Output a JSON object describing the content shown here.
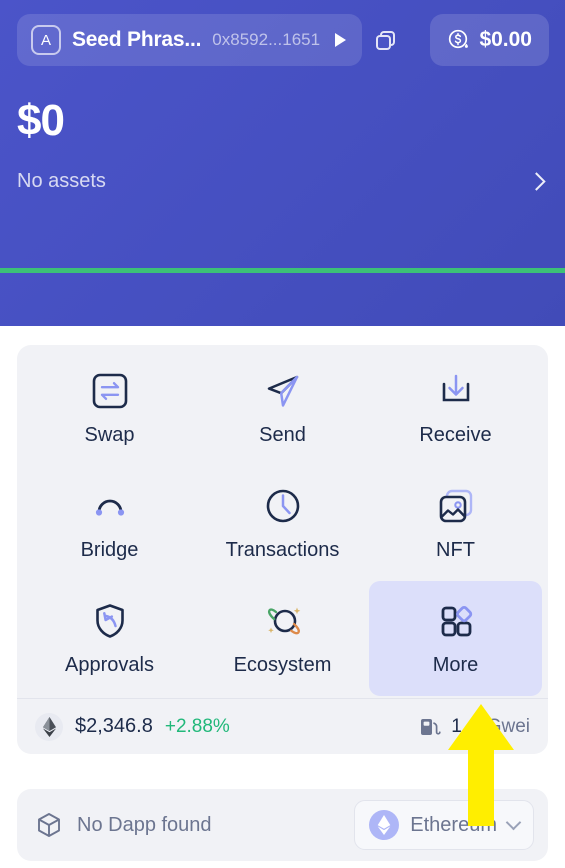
{
  "header": {
    "account_name": "Seed Phras...",
    "account_address": "0x8592...1651",
    "avatar_letter": "A",
    "caret_icon": "caret-right-icon",
    "copy_icon": "copy-icon",
    "fiat_icon": "dollar-drop-icon",
    "fiat_amount": "$0.00"
  },
  "balance": {
    "total": "$0",
    "assets_label": "No assets",
    "chevron_icon": "chevron-right-icon"
  },
  "actions": [
    {
      "label": "Swap",
      "icon": "swap-icon",
      "active": false
    },
    {
      "label": "Send",
      "icon": "send-plane-icon",
      "active": false
    },
    {
      "label": "Receive",
      "icon": "receive-icon",
      "active": false
    },
    {
      "label": "Bridge",
      "icon": "bridge-icon",
      "active": false
    },
    {
      "label": "Transactions",
      "icon": "clock-icon",
      "active": false
    },
    {
      "label": "NFT",
      "icon": "image-stack-icon",
      "active": false
    },
    {
      "label": "Approvals",
      "icon": "shield-arrow-icon",
      "active": false
    },
    {
      "label": "Ecosystem",
      "icon": "planet-icon",
      "active": false
    },
    {
      "label": "More",
      "icon": "grid-diamond-icon",
      "active": true
    }
  ],
  "pricebar": {
    "token_icon": "ethereum-icon",
    "price": "$2,346.8",
    "change": "+2.88%",
    "gas_icon": "gas-pump-icon",
    "gas_value": "1 4",
    "gas_unit": "Gwei"
  },
  "dappbar": {
    "cube_icon": "cube-icon",
    "status_text": "No Dapp found",
    "network_icon": "ethereum-icon",
    "network_name": "Ethereum",
    "chevron_icon": "chevron-down-icon"
  },
  "cursor": {
    "icon": "up-arrow-cursor",
    "color": "#ffee00"
  },
  "colors": {
    "hero_gradient_from": "#4b54c9",
    "hero_gradient_to": "#414bb8",
    "green_line": "#3cc177",
    "card_bg": "#f1f2f6",
    "tile_active_bg": "#dcdffa",
    "accent_purple": "#8b95f2",
    "ink": "#1d2b4a",
    "positive_green": "#21b87a"
  }
}
